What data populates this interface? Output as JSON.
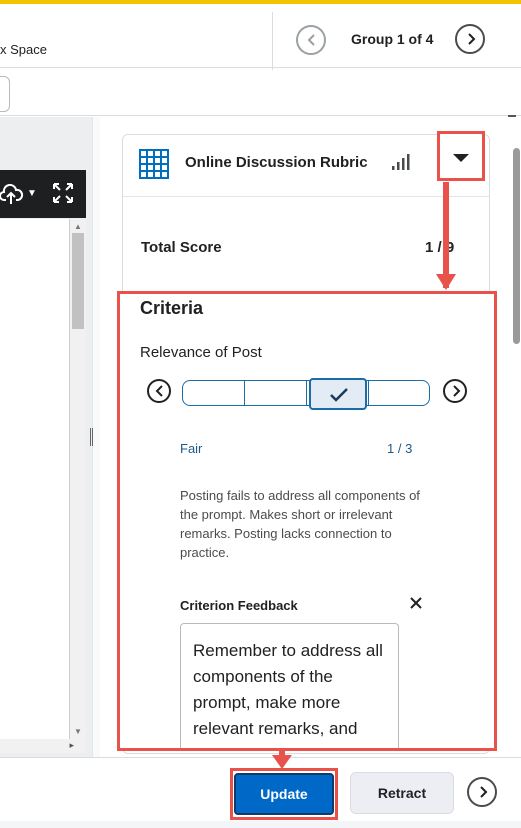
{
  "header": {
    "breadcrumb": "x Space",
    "group_label": "Group 1 of 4",
    "prev_icon": "chevron-left-icon",
    "next_icon": "chevron-right-icon"
  },
  "viewer": {
    "toolbar_icons": [
      "cloud-upload-icon",
      "caret-down-icon",
      "expand-icon"
    ]
  },
  "rubric": {
    "title": "Online Discussion Rubric",
    "icon": "grid-icon",
    "stats_icon": "signal-bars-icon",
    "toggle_icon": "caret-down-icon",
    "total_score_label": "Total Score",
    "total_score_value": "1 / 9",
    "criteria_heading": "Criteria",
    "criterion_name": "Relevance of Post",
    "level_count": 4,
    "selected_level_index": 2,
    "level_name": "Fair",
    "level_score": "1 / 3",
    "level_description": "Posting fails to address all components of the prompt. Makes short or irrelevant remarks. Posting lacks connection to practice.",
    "feedback_label": "Criterion Feedback",
    "feedback_text": "Remember to address all components of the prompt, make more relevant remarks, and"
  },
  "footer": {
    "update_label": "Update",
    "retract_label": "Retract"
  },
  "colors": {
    "highlight": "#e8524a",
    "primary": "#0068c7",
    "link_text": "#1a5a8c",
    "accent_bar": "#f2c300"
  }
}
